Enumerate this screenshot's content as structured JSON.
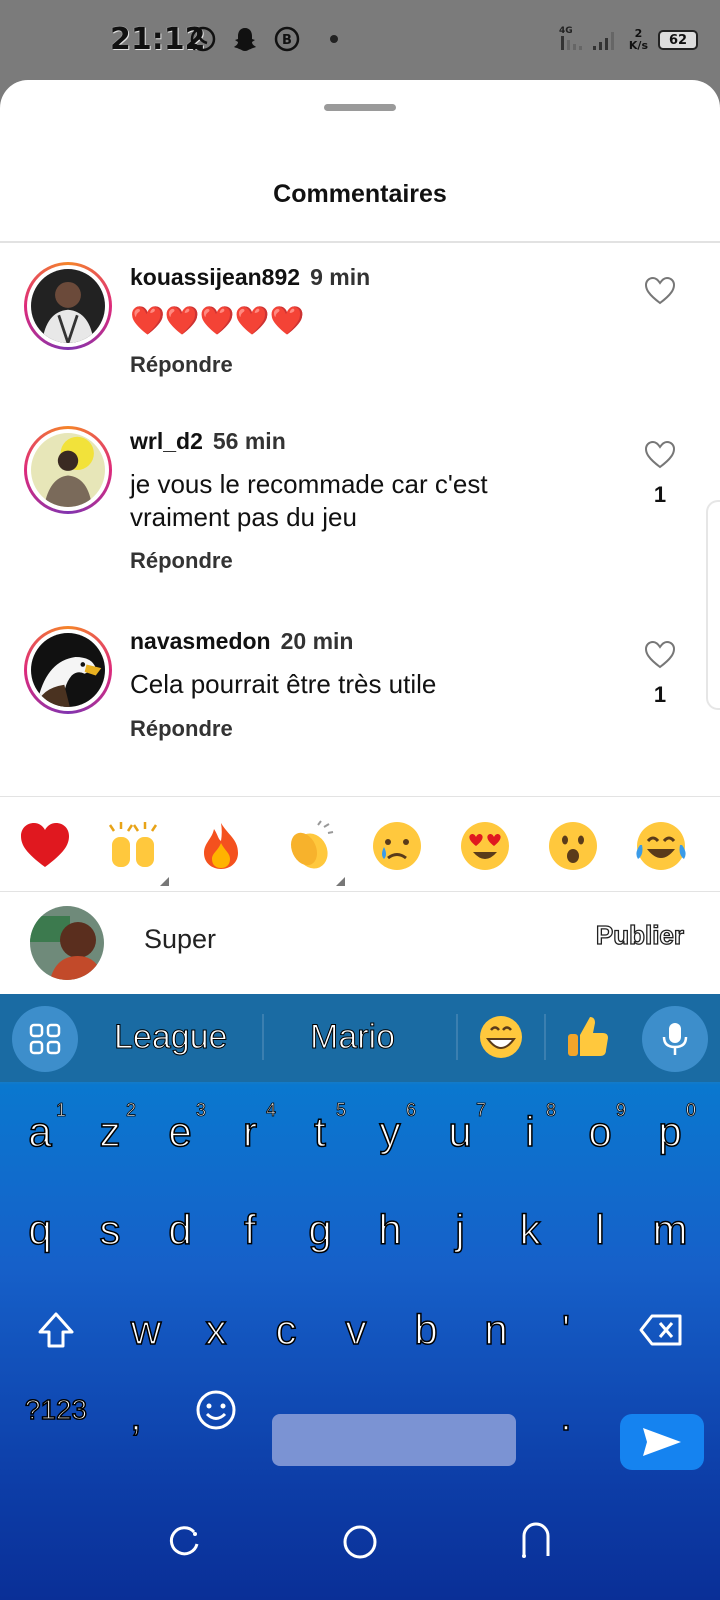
{
  "status_bar": {
    "time": "21:12",
    "network_speed_value": "2",
    "network_speed_unit": "K/s",
    "network_type": "4G",
    "battery": "62"
  },
  "sheet": {
    "title": "Commentaires"
  },
  "comments": [
    {
      "username": "kouassijean892",
      "time": "9 min",
      "text": "❤️❤️❤️❤️❤️",
      "reply_label": "Répondre",
      "likes": ""
    },
    {
      "username": "wrl_d2",
      "time": "56 min",
      "text": "je vous le recommade car c'est vraiment pas du jeu",
      "reply_label": "Répondre",
      "likes": "1"
    },
    {
      "username": "navasmedon",
      "time": "20 min",
      "text": "Cela pourrait être très utile",
      "reply_label": "Répondre",
      "likes": "1"
    }
  ],
  "emoji_bar": [
    "red-heart",
    "raising-hands",
    "fire",
    "clapping-hands",
    "crying-face",
    "heart-eyes",
    "astonished-face",
    "tears-of-joy"
  ],
  "composer": {
    "text": "Super",
    "publish_label": "Publier"
  },
  "keyboard": {
    "suggestions": [
      "League",
      "Mario"
    ],
    "row1": [
      {
        "k": "a",
        "n": "1"
      },
      {
        "k": "z",
        "n": "2"
      },
      {
        "k": "e",
        "n": "3"
      },
      {
        "k": "r",
        "n": "4"
      },
      {
        "k": "t",
        "n": "5"
      },
      {
        "k": "y",
        "n": "6"
      },
      {
        "k": "u",
        "n": "7"
      },
      {
        "k": "i",
        "n": "8"
      },
      {
        "k": "o",
        "n": "9"
      },
      {
        "k": "p",
        "n": "0"
      }
    ],
    "row2": [
      "q",
      "s",
      "d",
      "f",
      "g",
      "h",
      "j",
      "k",
      "l",
      "m"
    ],
    "row3": [
      "w",
      "x",
      "c",
      "v",
      "b",
      "n",
      "'"
    ],
    "symbols_label": "?123",
    "comma": ",",
    "period": "."
  }
}
